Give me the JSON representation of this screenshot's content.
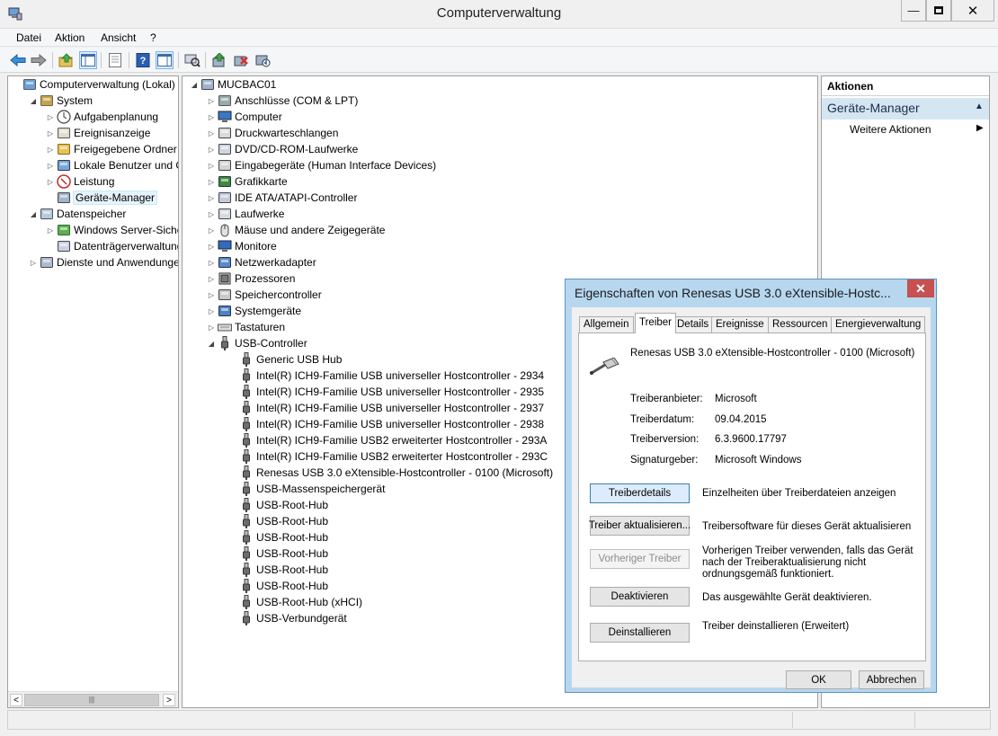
{
  "window": {
    "title": "Computerverwaltung"
  },
  "menu": [
    "Datei",
    "Aktion",
    "Ansicht",
    "?"
  ],
  "left_tree": [
    {
      "label": "Computerverwaltung (Lokal)",
      "level": 0,
      "expander": "",
      "icon": "computer-management-icon"
    },
    {
      "label": "System",
      "level": 1,
      "expander": "open",
      "icon": "system-tools-icon"
    },
    {
      "label": "Aufgabenplanung",
      "level": 2,
      "expander": "closed",
      "icon": "clock-icon"
    },
    {
      "label": "Ereignisanzeige",
      "level": 2,
      "expander": "closed",
      "icon": "event-viewer-icon"
    },
    {
      "label": "Freigegebene Ordner",
      "level": 2,
      "expander": "closed",
      "icon": "shared-folder-icon"
    },
    {
      "label": "Lokale Benutzer und Gr",
      "level": 2,
      "expander": "closed",
      "icon": "users-icon"
    },
    {
      "label": "Leistung",
      "level": 2,
      "expander": "closed",
      "icon": "performance-icon"
    },
    {
      "label": "Geräte-Manager",
      "level": 2,
      "expander": "",
      "icon": "device-manager-icon",
      "selected": true
    },
    {
      "label": "Datenspeicher",
      "level": 1,
      "expander": "open",
      "icon": "storage-icon"
    },
    {
      "label": "Windows Server-Sicheru",
      "level": 2,
      "expander": "closed",
      "icon": "backup-icon"
    },
    {
      "label": "Datenträgerverwaltung",
      "level": 2,
      "expander": "",
      "icon": "disk-management-icon"
    },
    {
      "label": "Dienste und Anwendungen",
      "level": 1,
      "expander": "closed",
      "icon": "services-icon"
    }
  ],
  "device_root": "MUCBAC01",
  "device_categories": [
    {
      "label": "Anschlüsse (COM & LPT)",
      "icon": "port-icon"
    },
    {
      "label": "Computer",
      "icon": "computer-icon"
    },
    {
      "label": "Druckwarteschlangen",
      "icon": "printer-icon"
    },
    {
      "label": "DVD/CD-ROM-Laufwerke",
      "icon": "dvd-drive-icon"
    },
    {
      "label": "Eingabegeräte (Human Interface Devices)",
      "icon": "hid-icon"
    },
    {
      "label": "Grafikkarte",
      "icon": "display-adapter-icon"
    },
    {
      "label": "IDE ATA/ATAPI-Controller",
      "icon": "ide-controller-icon"
    },
    {
      "label": "Laufwerke",
      "icon": "disk-drive-icon"
    },
    {
      "label": "Mäuse und andere Zeigegeräte",
      "icon": "mouse-icon"
    },
    {
      "label": "Monitore",
      "icon": "monitor-icon"
    },
    {
      "label": "Netzwerkadapter",
      "icon": "network-adapter-icon"
    },
    {
      "label": "Prozessoren",
      "icon": "processor-icon"
    },
    {
      "label": "Speichercontroller",
      "icon": "storage-controller-icon"
    },
    {
      "label": "Systemgeräte",
      "icon": "system-device-icon"
    },
    {
      "label": "Tastaturen",
      "icon": "keyboard-icon"
    },
    {
      "label": "USB-Controller",
      "icon": "usb-icon",
      "expanded": true
    }
  ],
  "usb_devices": [
    "Generic USB Hub",
    "Intel(R) ICH9-Familie USB universeller Hostcontroller - 2934",
    "Intel(R) ICH9-Familie USB universeller Hostcontroller - 2935",
    "Intel(R) ICH9-Familie USB universeller Hostcontroller - 2937",
    "Intel(R) ICH9-Familie USB universeller Hostcontroller - 2938",
    "Intel(R) ICH9-Familie USB2 erweiterter Hostcontroller - 293A",
    "Intel(R) ICH9-Familie USB2 erweiterter Hostcontroller - 293C",
    "Renesas USB 3.0 eXtensible-Hostcontroller - 0100 (Microsoft)",
    "USB-Massenspeichergerät",
    "USB-Root-Hub",
    "USB-Root-Hub",
    "USB-Root-Hub",
    "USB-Root-Hub",
    "USB-Root-Hub",
    "USB-Root-Hub",
    "USB-Root-Hub (xHCI)",
    "USB-Verbundgerät"
  ],
  "actions": {
    "header": "Aktionen",
    "section": "Geräte-Manager",
    "more": "Weitere Aktionen"
  },
  "dialog": {
    "title": "Eigenschaften von Renesas USB 3.0 eXtensible-Hostc...",
    "tabs": [
      "Allgemein",
      "Treiber",
      "Details",
      "Ereignisse",
      "Ressourcen",
      "Energieverwaltung"
    ],
    "active_tab": "Treiber",
    "device_name": "Renesas USB 3.0 eXtensible-Hostcontroller - 0100 (Microsoft)",
    "fields": [
      {
        "label": "Treiberanbieter:",
        "value": "Microsoft"
      },
      {
        "label": "Treiberdatum:",
        "value": "09.04.2015"
      },
      {
        "label": "Treiberversion:",
        "value": "6.3.9600.17797"
      },
      {
        "label": "Signaturgeber:",
        "value": "Microsoft Windows"
      }
    ],
    "buttons": [
      {
        "label": "Treiberdetails",
        "desc": "Einzelheiten über Treiberdateien anzeigen",
        "state": "focus"
      },
      {
        "label": "Treiber aktualisieren...",
        "desc": "Treibersoftware für dieses Gerät aktualisieren",
        "state": "normal"
      },
      {
        "label": "Vorheriger Treiber",
        "desc": "Vorherigen Treiber verwenden, falls das Gerät nach der Treiberaktualisierung nicht ordnungsgemäß funktioniert.",
        "state": "disabled"
      },
      {
        "label": "Deaktivieren",
        "desc": "Das ausgewählte Gerät deaktivieren.",
        "state": "normal"
      },
      {
        "label": "Deinstallieren",
        "desc": "Treiber deinstallieren (Erweitert)",
        "state": "normal"
      }
    ],
    "ok": "OK",
    "cancel": "Abbrechen"
  },
  "colors": {
    "selection": "#e5f3fb",
    "dialog_frame": "#b7d7ef",
    "close_red": "#c75050",
    "actions_header": "#d5e6f3"
  }
}
